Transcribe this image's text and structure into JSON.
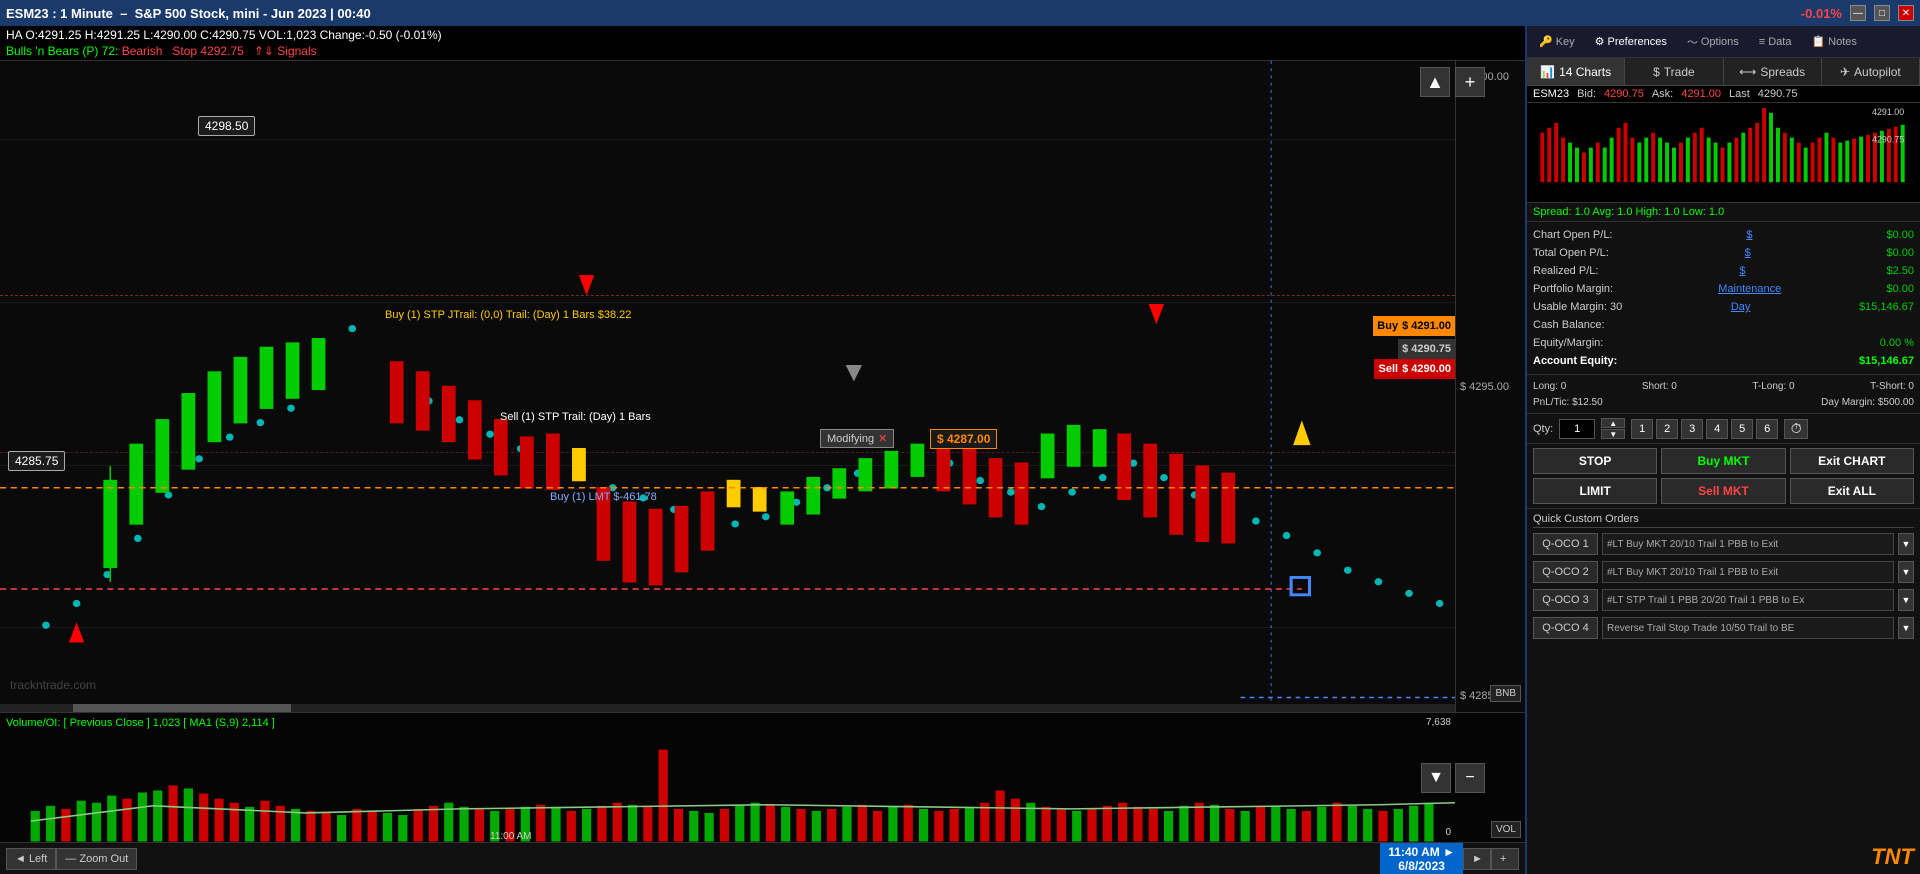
{
  "titleBar": {
    "symbol": "ESM23 : 1 Minute",
    "description": "S&P 500 Stock, mini - Jun 2023 | 00:40",
    "change": "-0.01%",
    "minimizeBtn": "—",
    "maximizeBtn": "□",
    "closeBtn": "✕"
  },
  "chartHeader": {
    "ohlcRow": "HA O:4291.25  H:4291.25  L:4290.00  C:4290.75  VOL:1,023   Change:-0.50 (-0.01%)",
    "bullsLabel": "Bulls 'n Bears (P) 72:",
    "bearishLabel": "Bearish",
    "stopLabel": "Stop 4292.75",
    "signalsLabel": "⇑⇓ Signals"
  },
  "priceScale": {
    "p4300": "$ 4300.00",
    "p4295": "$ 4295.00",
    "p4285": "$ 4285.00"
  },
  "callouts": {
    "high": "4298.50",
    "low": "4285.75"
  },
  "tradeLabels": {
    "buy": "Buy (1) STP JTrail: (0,0) Trail: (Day) 1 Bars  $38.22",
    "sell": "Sell (1) STP Trail: (Day) 1 Bars",
    "buyLmt": "Buy (1) LMT  $-461.78",
    "modifying": "Modifying",
    "modifyingX": "✕",
    "price4291": "$ 4291.00",
    "price4290_75": "$ 4290.75",
    "price4290_00": "$ 4290.00",
    "price4287": "$ 4287.00"
  },
  "buySellBtns": {
    "buy": "Buy",
    "sell": "Sell"
  },
  "volumeArea": {
    "label": "Volume/OI:  [ Previous Close ]  1,023  [ MA1 (S,9) 2,114 ]",
    "maxValue": "7,638",
    "minValue": "0"
  },
  "bottomToolbar": {
    "leftBtn": "◄  Left",
    "zoomBtn": "—  Zoom Out",
    "timeDisplay": "11:40 AM\n6/8/2023",
    "rightArrow": "►",
    "plusBtn": "+"
  },
  "rightPanel": {
    "topTabs": [
      {
        "id": "key",
        "label": "Key",
        "icon": "🔑"
      },
      {
        "id": "preferences",
        "label": "Preferences",
        "icon": "⚙"
      },
      {
        "id": "options",
        "label": "Options",
        "icon": "~"
      },
      {
        "id": "data",
        "label": "Data",
        "icon": "≡"
      },
      {
        "id": "notes",
        "label": "Notes",
        "icon": "📋"
      }
    ],
    "midTabs": [
      {
        "id": "charts",
        "label": "14 Charts",
        "icon": "📊"
      },
      {
        "id": "trade",
        "label": "Trade",
        "icon": "$"
      },
      {
        "id": "spreads",
        "label": "Spreads",
        "icon": "⟷"
      },
      {
        "id": "autopilot",
        "label": "Autopilot",
        "icon": "✈"
      }
    ],
    "bidAsk": {
      "symbol": "ESM23",
      "bidLabel": "Bid:",
      "bid": "4290.75",
      "askLabel": "Ask:",
      "ask": "4291.00",
      "lastLabel": "Last",
      "last": "4290.75"
    },
    "spreadInfo": "Spread: 1.0  Avg: 1.0  High: 1.0  Low: 1.0",
    "pnl": {
      "chartOpenPL": "Chart Open P/L:",
      "chartOpenPLLink": "$",
      "chartOpenPLValue": "$0.00",
      "totalOpenPL": "Total Open P/L:",
      "totalOpenPLLink": "$",
      "totalOpenPLValue": "$0.00",
      "realizedPL": "Realized P/L:",
      "realizedPLLink": "$",
      "realizedPLValue": "$2.50",
      "portfolioMargin": "Portfolio Margin:",
      "maintenanceLink": "Maintenance",
      "portfolioMarginValue": "$0.00",
      "usableMargin": "Usable Margin: 30",
      "dayLink": "Day",
      "usableMarginValue": "$15,146.67",
      "cashBalance": "Cash Balance:",
      "cashBalanceValue": "",
      "equityMargin": "Equity/Margin:",
      "equityMarginValue": "0.00 %",
      "accountEquity": "Account Equity:",
      "accountEquityValue": "$15,146.67"
    },
    "account": {
      "long": "Long: 0",
      "short": "Short: 0",
      "tLong": "T-Long: 0",
      "tShort": "T-Short: 0",
      "pnlTic": "PnL/Tic: $12.50",
      "dayMargin": "Day Margin: $500.00"
    },
    "qty": {
      "label": "Qty:",
      "value": "1",
      "spinUp": "▲",
      "spinDown": "▼",
      "presets": [
        "1",
        "2",
        "3",
        "4",
        "5",
        "6"
      ],
      "clockIcon": "⏱"
    },
    "actionButtons": [
      {
        "id": "stop",
        "label": "STOP"
      },
      {
        "id": "buy-mkt",
        "label": "Buy MKT"
      },
      {
        "id": "exit-chart",
        "label": "Exit CHART"
      },
      {
        "id": "limit",
        "label": "LIMIT"
      },
      {
        "id": "sell-mkt",
        "label": "Sell MKT"
      },
      {
        "id": "exit-all",
        "label": "Exit ALL"
      }
    ],
    "qco": {
      "title": "Quick Custom Orders",
      "orders": [
        {
          "id": "qco1",
          "label": "Q-OCO 1",
          "value": "#LT Buy MKT 20/10 Trail 1 PBB to Exit"
        },
        {
          "id": "qco2",
          "label": "Q-OCO 2",
          "value": "#LT Buy MKT 20/10 Trail 1 PBB to Exit"
        },
        {
          "id": "qco3",
          "label": "Q-OCO 3",
          "value": "#LT STP Trail 1 PBB 20/20 Trail 1 PBB to Ex"
        },
        {
          "id": "qco4",
          "label": "Q-OCO 4",
          "value": "Reverse Trail Stop Trade 10/50 Trail to BE"
        }
      ]
    }
  },
  "website": "trackntrade.com",
  "tntLogo": "TNT"
}
